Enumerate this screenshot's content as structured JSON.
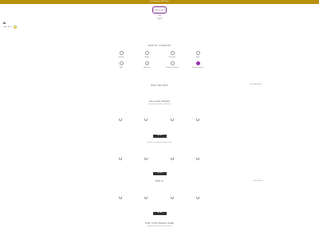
{
  "announcement": "Free Shipping on All Orders",
  "header": {
    "logo_text": "Lorem Ipsum Co.",
    "logo_lines": [
      "Shop",
      "Collection",
      "Store"
    ]
  },
  "utility": {
    "label": "Help / Store",
    "badge": "0"
  },
  "categories_section": {
    "title": "SHOP BY CATEGORY",
    "items": [
      {
        "label": "Furniture",
        "icon": "furniture-icon"
      },
      {
        "label": "Lighting",
        "icon": "lighting-icon"
      },
      {
        "label": "Decoration",
        "icon": "decoration-icon"
      },
      {
        "label": "Rugs",
        "icon": "rugs-icon"
      },
      {
        "label": "Beds",
        "icon": "beds-icon"
      },
      {
        "label": "Bathroom",
        "icon": "bathroom-icon"
      },
      {
        "label": "Outdoor and Garden",
        "icon": "outdoor-icon"
      },
      {
        "label": "Kids and Nursery",
        "icon": "kids-icon"
      }
    ]
  },
  "bestsellers": {
    "title": "BEST SELLERS",
    "link": "See all Best Sellers"
  },
  "sale": {
    "title": "SALE AND OFFERS",
    "subtitle": "Discover our selection of sale items",
    "button": "SEE ALL",
    "note": "Discover our selection of items on sale"
  },
  "new_in": {
    "button": "SEE ALL",
    "title": "NEW IN",
    "link": "See all New In"
  },
  "more": {
    "button": "SEE ALL",
    "title": "FIND YOUR DREAM HOME",
    "subtitle": "Explore our collections for every space"
  }
}
